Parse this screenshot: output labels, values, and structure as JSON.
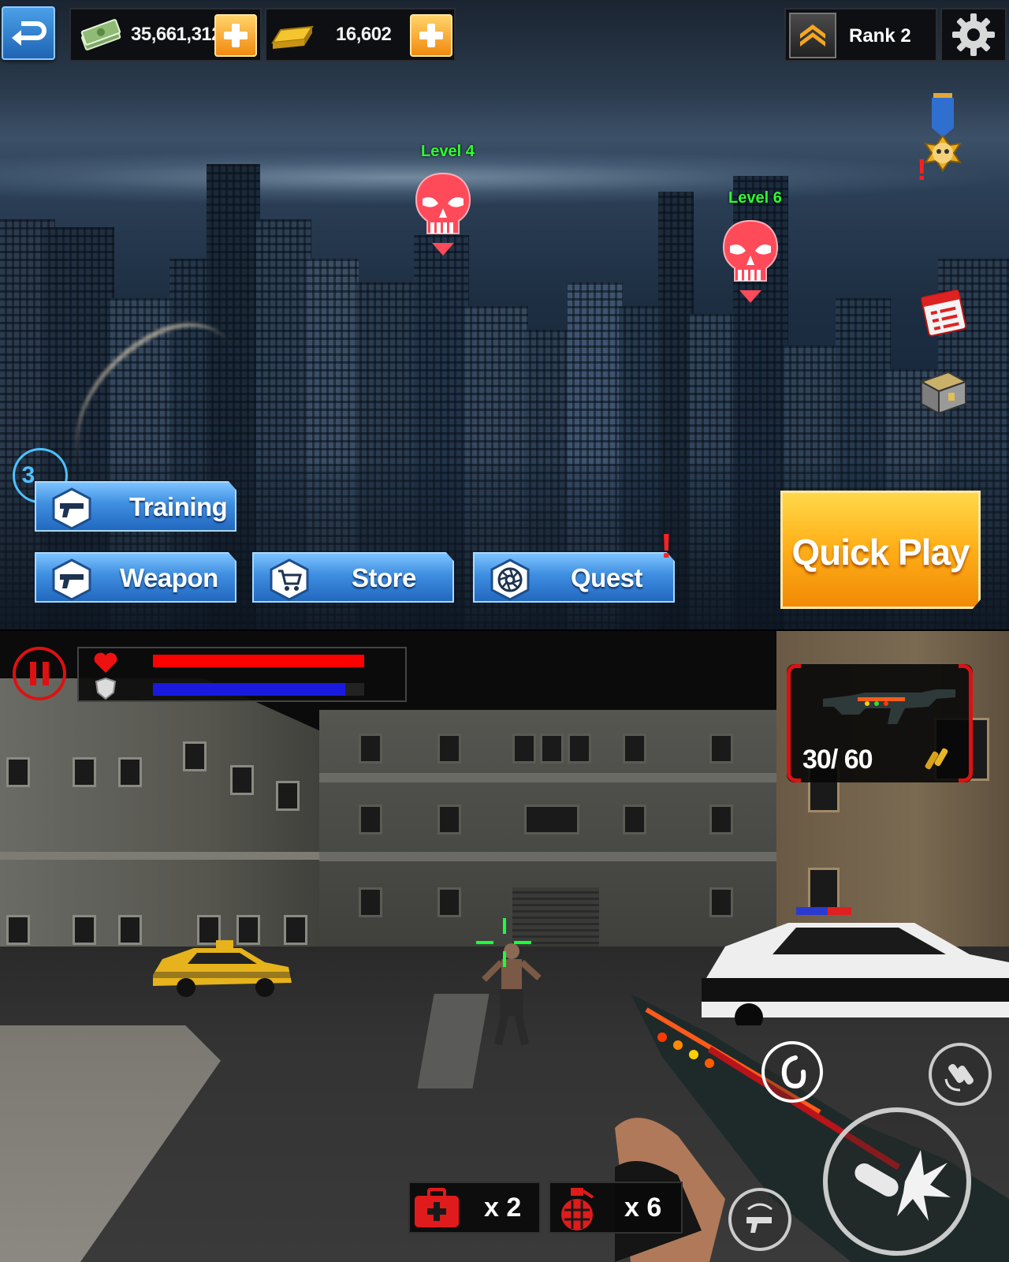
{
  "lobby": {
    "currency": {
      "cash_value": "35,661,312",
      "gold_value": "16,602"
    },
    "rank": {
      "label": "Rank 2"
    },
    "levels": [
      {
        "label": "Level 4"
      },
      {
        "label": "Level 6"
      }
    ],
    "notification": {
      "count": "3"
    },
    "menu": {
      "training_label": "Training",
      "weapon_label": "Weapon",
      "store_label": "Store",
      "quest_label": "Quest"
    },
    "quick_play_label": "Quick Play",
    "alert_mark": "!",
    "icons": [
      "back-icon",
      "cash-icon",
      "gold-bar-icon",
      "plus-icon",
      "rank-chevron-icon",
      "gear-icon",
      "medal-skull-icon",
      "calendar-icon",
      "treasure-chest-icon",
      "pistol-icon",
      "cart-icon",
      "aperture-icon",
      "skull-marker-icon"
    ]
  },
  "game": {
    "health_fraction": 1.0,
    "armor_fraction": 0.91,
    "ammo_text": "30/ 60",
    "medkit_qty": "x 2",
    "grenade_qty": "x 6",
    "colors": {
      "health": "#ff0000",
      "armor": "#1a1adf",
      "hud_red": "#dd1111",
      "crosshair": "#19ff3a"
    },
    "icons": [
      "pause-icon",
      "heart-icon",
      "shield-icon",
      "rifle-icon",
      "bullets-icon",
      "medkit-icon",
      "grenade-icon",
      "grenade-throw-icon",
      "reload-icon",
      "fire-icon",
      "weapon-swap-icon"
    ]
  }
}
